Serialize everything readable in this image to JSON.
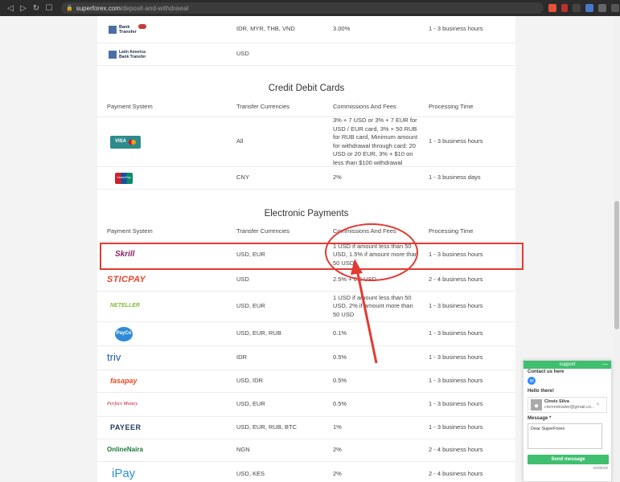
{
  "browser": {
    "url_domain": "superforex.com",
    "url_path": "/deposit-and-withdrawal"
  },
  "bank_rows": [
    {
      "logo_line1": "Bank",
      "logo_line2": "Transfer",
      "currencies": "IDR, MYR, THB, VND",
      "fees": "3.00%",
      "time": "1 - 3 business hours"
    },
    {
      "logo_line1": "Latin America",
      "logo_line2": "Bank Transfer",
      "currencies": "USD",
      "fees": "",
      "time": ""
    }
  ],
  "headers": {
    "payment_system": "Payment System",
    "transfer_currencies": "Transfer Currencies",
    "commissions": "Commissions And Fees",
    "processing_time": "Processing Time"
  },
  "credit_section": {
    "title": "Credit Debit Cards",
    "rows": [
      {
        "logo": "VISA",
        "currencies": "All",
        "fees": "3% + 7 USD or 3% + 7 EUR for USD / EUR card, 3% + 50 RUB for RUB card, Minimum amount for withdrawal through card: 20 USD or 20 EUR, 3% + $10 on less than $100 withdrawal",
        "time": "1 - 3 business hours"
      },
      {
        "logo": "UnionPay",
        "currencies": "CNY",
        "fees": "2%",
        "time": "1 - 3 business days"
      }
    ]
  },
  "electronic_section": {
    "title": "Electronic Payments",
    "rows": [
      {
        "logo": "Skrill",
        "currencies": "USD, EUR",
        "fees": "1 USD if amount less than 50 USD, 1.5% if amount more than 50 USD",
        "time": "1 - 3 business hours"
      },
      {
        "logo": "STICPAY",
        "currencies": "USD",
        "fees": "2.5% + 0.3 USD",
        "time": "2 - 4 business hours"
      },
      {
        "logo": "NETELLER",
        "currencies": "USD, EUR",
        "fees": "1 USD if amount less than 50 USD, 2% if amount more than 50 USD",
        "time": "1 - 3 business hours"
      },
      {
        "logo": "PayCo",
        "currencies": "USD, EUR, RUB",
        "fees": "0.1%",
        "time": "1 - 3 business hours"
      },
      {
        "logo": "triv",
        "currencies": "IDR",
        "fees": "0.5%",
        "time": "1 - 3 business hours"
      },
      {
        "logo": "fasapay",
        "currencies": "USD, IDR",
        "fees": "0.5%",
        "time": "1 - 3 business hours"
      },
      {
        "logo": "Perfect Money",
        "currencies": "USD, EUR",
        "fees": "0.5%",
        "time": "1 - 3 business hours"
      },
      {
        "logo": "PAYEER",
        "currencies": "USD, EUR, RUB, BTC",
        "fees": "1%",
        "time": "1 - 3 business hours"
      },
      {
        "logo": "OnlineNaira",
        "currencies": "NGN",
        "fees": "2%",
        "time": "2 - 4 business hours"
      },
      {
        "logo": "iPay",
        "currencies": "USD, KES",
        "fees": "2%",
        "time": "2 - 4 business hours"
      }
    ]
  },
  "chat": {
    "header": "support",
    "minimize": "—",
    "contact_label": "Contact us here",
    "greeting": "Hello there!",
    "agent_name": "Clovis Silva",
    "agent_email": "clemmitrader@gmail.co...",
    "message_label": "Message *",
    "message_value": "Dear SuperForex",
    "send_label": "Send message",
    "brand": "zendesk"
  },
  "colors": {
    "annotation": "#e23a32",
    "chat_green": "#3fbf6f",
    "skrill": "#862165",
    "sticpay": "#e8432b",
    "neteller": "#83ba3b",
    "payco": "#2f8bd8",
    "triv": "#1d5ea8",
    "fasapay": "#e84a1f",
    "payeer": "#1f3a5f",
    "onlinenaira": "#1a7a3c",
    "ipay": "#2a8fd6"
  }
}
